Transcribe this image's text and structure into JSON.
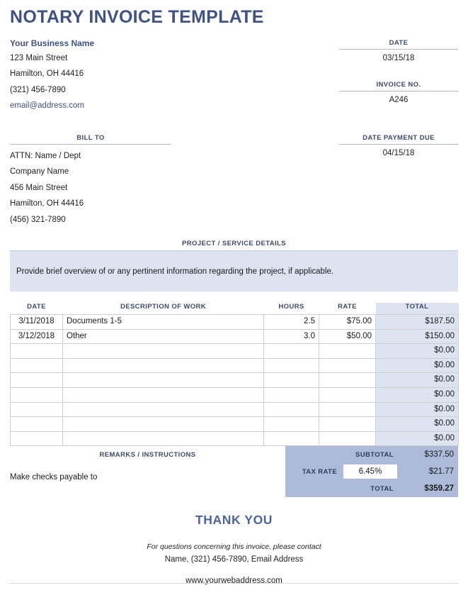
{
  "document": {
    "title": "NOTARY INVOICE TEMPLATE"
  },
  "business": {
    "name": "Your Business Name",
    "street": "123 Main Street",
    "city_state_zip": "Hamilton, OH 44416",
    "phone": "(321) 456-7890",
    "email": "email@address.com"
  },
  "meta": {
    "date_label": "DATE",
    "date_value": "03/15/18",
    "invoice_no_label": "INVOICE NO.",
    "invoice_no_value": "A246",
    "due_label": "DATE PAYMENT DUE",
    "due_value": "04/15/18"
  },
  "bill_to": {
    "label": "BILL TO",
    "lines": [
      "ATTN: Name / Dept",
      "Company Name",
      "456 Main Street",
      "Hamilton, OH 44416",
      "(456) 321-7890"
    ]
  },
  "project": {
    "label": "PROJECT / SERVICE DETAILS",
    "text": "Provide brief overview of or any pertinent information regarding the project, if applicable."
  },
  "work_table": {
    "headers": {
      "date": "DATE",
      "description": "DESCRIPTION OF WORK",
      "hours": "HOURS",
      "rate": "RATE",
      "total": "TOTAL"
    },
    "rows": [
      {
        "date": "3/11/2018",
        "description": "Documents 1-5",
        "hours": "2.5",
        "rate": "$75.00",
        "total": "$187.50"
      },
      {
        "date": "3/12/2018",
        "description": "Other",
        "hours": "3.0",
        "rate": "$50.00",
        "total": "$150.00"
      },
      {
        "date": "",
        "description": "",
        "hours": "",
        "rate": "",
        "total": "$0.00"
      },
      {
        "date": "",
        "description": "",
        "hours": "",
        "rate": "",
        "total": "$0.00"
      },
      {
        "date": "",
        "description": "",
        "hours": "",
        "rate": "",
        "total": "$0.00"
      },
      {
        "date": "",
        "description": "",
        "hours": "",
        "rate": "",
        "total": "$0.00"
      },
      {
        "date": "",
        "description": "",
        "hours": "",
        "rate": "",
        "total": "$0.00"
      },
      {
        "date": "",
        "description": "",
        "hours": "",
        "rate": "",
        "total": "$0.00"
      },
      {
        "date": "",
        "description": "",
        "hours": "",
        "rate": "",
        "total": "$0.00"
      }
    ]
  },
  "remarks": {
    "label": "REMARKS / INSTRUCTIONS",
    "text": "Make checks payable to"
  },
  "totals": {
    "subtotal_label": "SUBTOTAL",
    "subtotal_value": "$337.50",
    "tax_rate_label": "TAX RATE",
    "tax_rate_value": "6.45%",
    "tax_amount_value": "$21.77",
    "total_label": "TOTAL",
    "total_value": "$359.27"
  },
  "footer": {
    "thank_you": "THANK YOU",
    "contact_intro": "For questions concerning this invoice, please contact",
    "contact_line": "Name, (321) 456-7890, Email Address",
    "website": "www.yourwebaddress.com"
  },
  "colors": {
    "accent_blue": "#3e5284",
    "label_blue": "#3e4a6b",
    "panel_light": "#dde3f0",
    "panel_strong": "#aebada",
    "thank_you_blue": "#4c63a0"
  }
}
